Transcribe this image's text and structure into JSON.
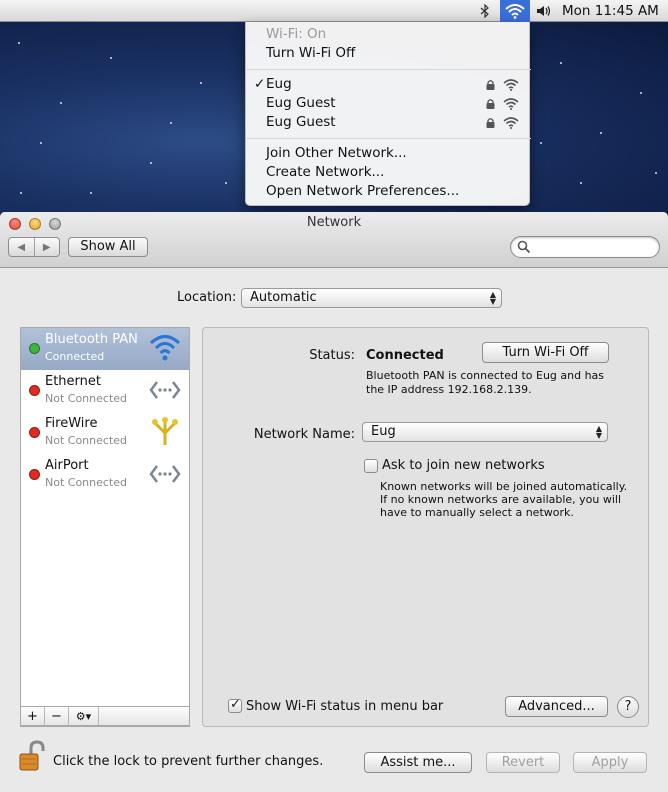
{
  "menubar": {
    "clock": "Mon 11:45 AM",
    "icons": [
      "bluetooth-icon",
      "wifi-icon",
      "volume-icon"
    ],
    "wifi_highlight_color": "#3a6ed8"
  },
  "wifi_menu": {
    "status": "Wi-Fi: On",
    "toggle": "Turn Wi-Fi Off",
    "networks": [
      {
        "name": "Eug",
        "checked": true,
        "locked": true
      },
      {
        "name": "Eug Guest",
        "checked": false,
        "locked": true
      },
      {
        "name": "Eug Guest",
        "checked": false,
        "locked": true
      }
    ],
    "check_mark": "✓",
    "join_other": "Join Other Network...",
    "create": "Create Network...",
    "open_prefs": "Open Network Preferences..."
  },
  "window": {
    "title": "Network",
    "show_all": "Show All",
    "search_placeholder": ""
  },
  "location": {
    "label": "Location:",
    "value": "Automatic"
  },
  "services": [
    {
      "name": "Bluetooth PAN",
      "status": "Connected",
      "dot_color": "#3db53d",
      "icon": "wifi-icon",
      "selected": true
    },
    {
      "name": "Ethernet",
      "status": "Not Connected",
      "dot_color": "#e02b20",
      "icon": "ethernet-icon",
      "selected": false
    },
    {
      "name": "FireWire",
      "status": "Not Connected",
      "dot_color": "#e02b20",
      "icon": "firewire-icon",
      "selected": false
    },
    {
      "name": "AirPort",
      "status": "Not Connected",
      "dot_color": "#e02b20",
      "icon": "ethernet-icon",
      "selected": false
    }
  ],
  "list_buttons": {
    "add": "+",
    "remove": "−",
    "gear": "⚙▾"
  },
  "detail": {
    "status_label": "Status:",
    "status_value": "Connected",
    "toggle_button": "Turn Wi-Fi Off",
    "status_desc_1": "Bluetooth PAN is connected to Eug and has",
    "status_desc_2": "the IP address 192.168.2.139.",
    "network_name_label": "Network Name:",
    "network_name_value": "Eug",
    "ask_join_label": "Ask to join new networks",
    "ask_join_checked": false,
    "ask_desc_1": "Known networks will be joined automatically.",
    "ask_desc_2": "If no known networks are available, you will",
    "ask_desc_3": "have to manually select a network.",
    "show_status_label": "Show Wi-Fi status in menu bar",
    "show_status_checked": true,
    "advanced": "Advanced...",
    "help": "?"
  },
  "footer": {
    "lock_text": "Click the lock to prevent further changes.",
    "assist": "Assist me...",
    "revert": "Revert",
    "apply": "Apply"
  }
}
